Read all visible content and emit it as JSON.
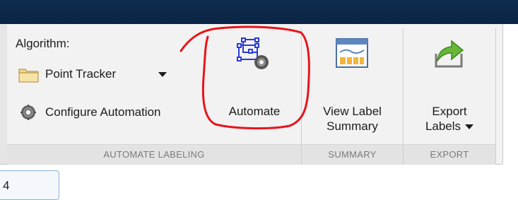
{
  "ribbon": {
    "automate_labeling": {
      "algorithm_label": "Algorithm:",
      "algorithm_value": "Point Tracker",
      "configure_label": "Configure Automation",
      "automate_label": "Automate",
      "group_label": "AUTOMATE LABELING"
    },
    "summary": {
      "view_line1": "View Label",
      "view_line2": "Summary",
      "group_label": "SUMMARY"
    },
    "export": {
      "export_line1": "Export",
      "export_line2": "Labels",
      "group_label": "EXPORT"
    }
  },
  "lower": {
    "tab_text": "4"
  },
  "icons": {
    "algorithm": "folder-icon",
    "configure": "gear-icon",
    "automate": "automate-network-gear-icon",
    "summary": "label-summary-icon",
    "export": "export-arrow-icon"
  },
  "colors": {
    "annotation": "#e8141b",
    "titlebar": "#0f2d4f",
    "group_label_bg": "#e3e3e3"
  }
}
